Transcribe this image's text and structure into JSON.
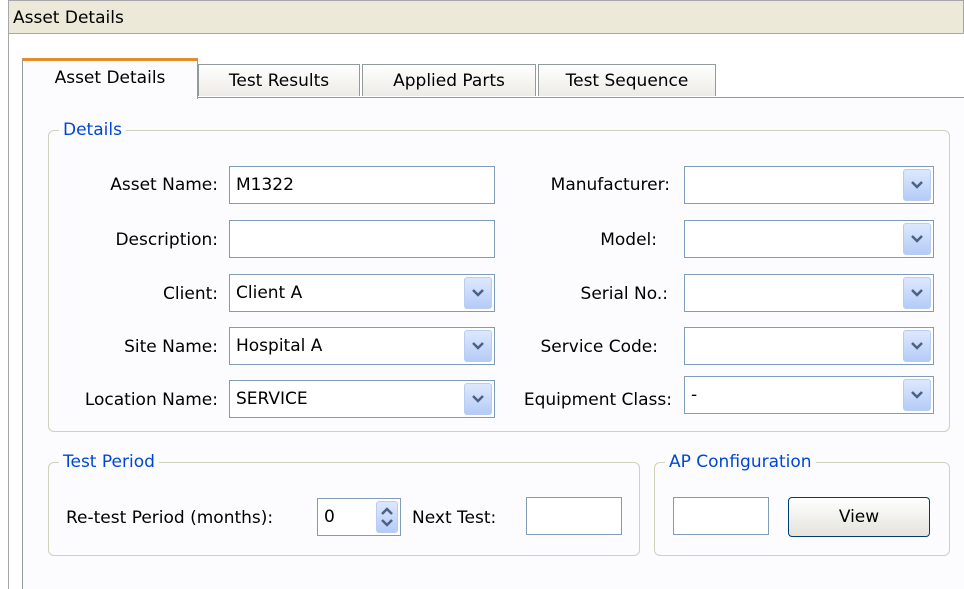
{
  "window": {
    "title": "Asset Details"
  },
  "tabs": [
    {
      "label": "Asset Details",
      "active": true
    },
    {
      "label": "Test Results",
      "active": false
    },
    {
      "label": "Applied Parts",
      "active": false
    },
    {
      "label": "Test Sequence",
      "active": false
    }
  ],
  "details": {
    "title": "Details",
    "asset_name": {
      "label": "Asset Name:",
      "value": "M1322"
    },
    "description": {
      "label": "Description:",
      "value": ""
    },
    "client": {
      "label": "Client:",
      "value": "Client A"
    },
    "site_name": {
      "label": "Site Name:",
      "value": "Hospital A"
    },
    "location_name": {
      "label": "Location Name:",
      "value": "SERVICE"
    },
    "manufacturer": {
      "label": "Manufacturer:",
      "value": ""
    },
    "model": {
      "label": "Model:",
      "value": ""
    },
    "serial_no": {
      "label": "Serial No.:",
      "value": ""
    },
    "service_code": {
      "label": "Service Code:",
      "value": ""
    },
    "equipment_class": {
      "label": "Equipment Class:",
      "value": "-"
    }
  },
  "test_period": {
    "title": "Test Period",
    "retest_label": "Re-test Period (months):",
    "retest_value": "0",
    "next_test_label": "Next Test:",
    "next_test_value": ""
  },
  "ap_config": {
    "title": "AP Configuration",
    "value": "",
    "view_label": "View"
  },
  "colors": {
    "accent": "#e68b2c",
    "group_title": "#0046d5",
    "field_border": "#7f9db9"
  },
  "icons": {
    "dropdown": "chevron-down-icon",
    "spinner": "spin-arrows-icon"
  }
}
